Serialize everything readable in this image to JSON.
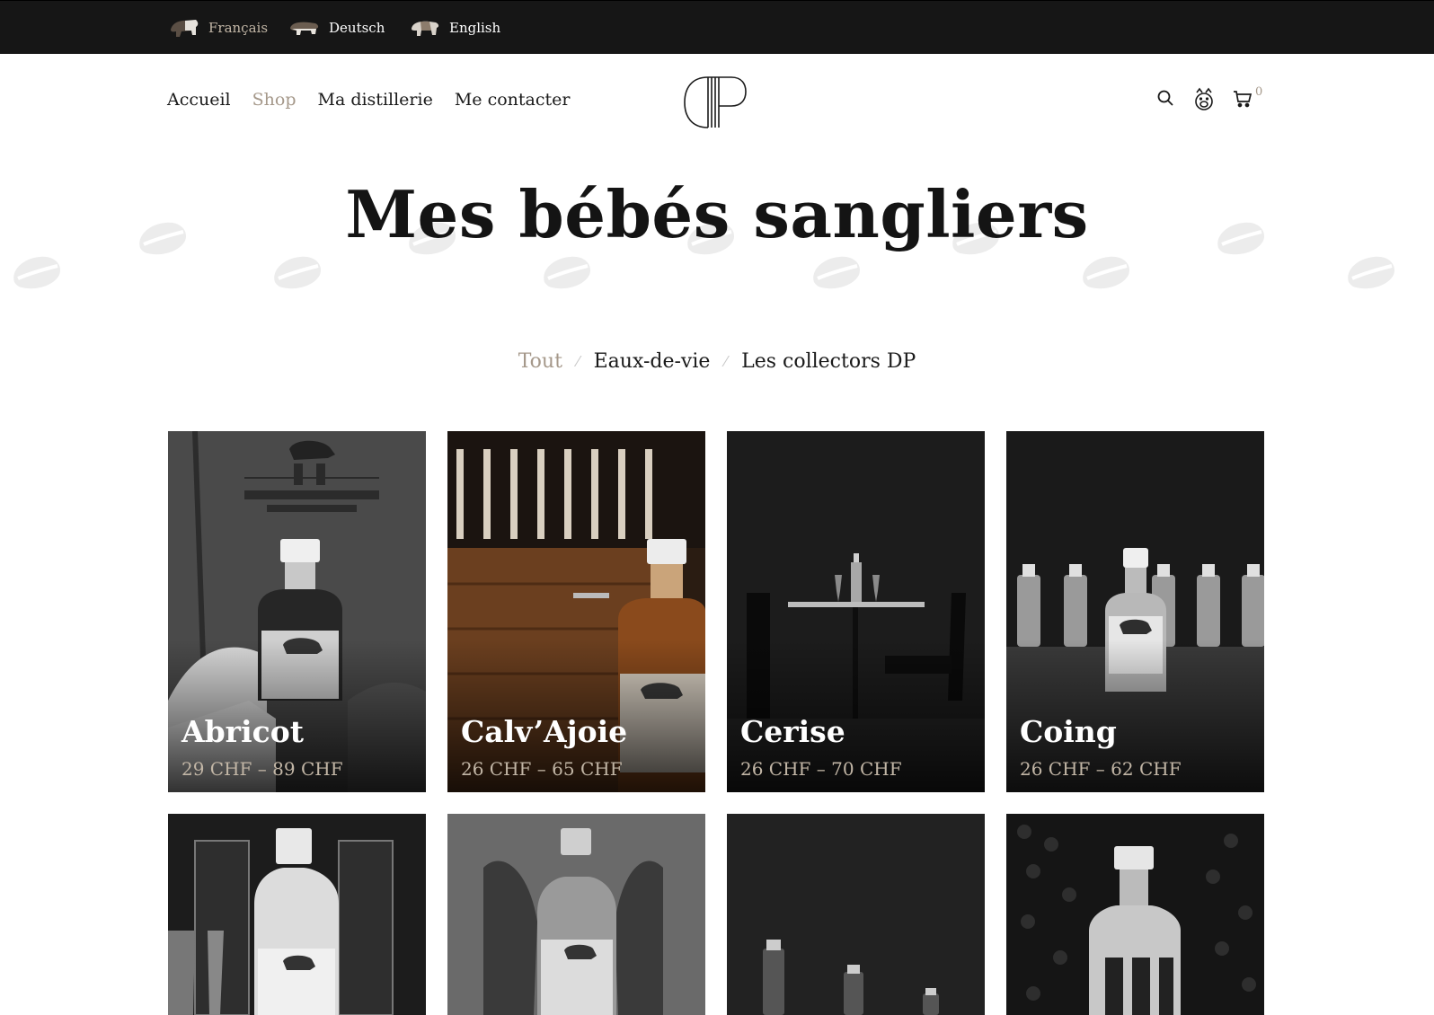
{
  "languages": [
    {
      "label": "Français",
      "active": true
    },
    {
      "label": "Deutsch",
      "active": false
    },
    {
      "label": "English",
      "active": false
    }
  ],
  "nav": [
    {
      "label": "Accueil",
      "active": false
    },
    {
      "label": "Shop",
      "active": true
    },
    {
      "label": "Ma distillerie",
      "active": false
    },
    {
      "label": "Me contacter",
      "active": false
    }
  ],
  "header_icons": [
    "search-icon",
    "account-icon",
    "cart-icon"
  ],
  "cart": {
    "count": "0"
  },
  "page_title": "Mes bébés sangliers",
  "filters": [
    {
      "label": "Tout",
      "active": true
    },
    {
      "label": "Eaux-de-vie",
      "active": false
    },
    {
      "label": "Les collectors DP",
      "active": false
    }
  ],
  "products": [
    {
      "name": "Abricot",
      "price": "29 CHF – 89 CHF"
    },
    {
      "name": "Calv’Ajoie",
      "price": "26 CHF – 65 CHF"
    },
    {
      "name": "Cerise",
      "price": "26 CHF – 70 CHF"
    },
    {
      "name": "Coing",
      "price": "26 CHF – 62 CHF"
    }
  ],
  "colors": {
    "accent": "#a5988a",
    "topbar": "#161616",
    "price": "#c2b6a6"
  }
}
